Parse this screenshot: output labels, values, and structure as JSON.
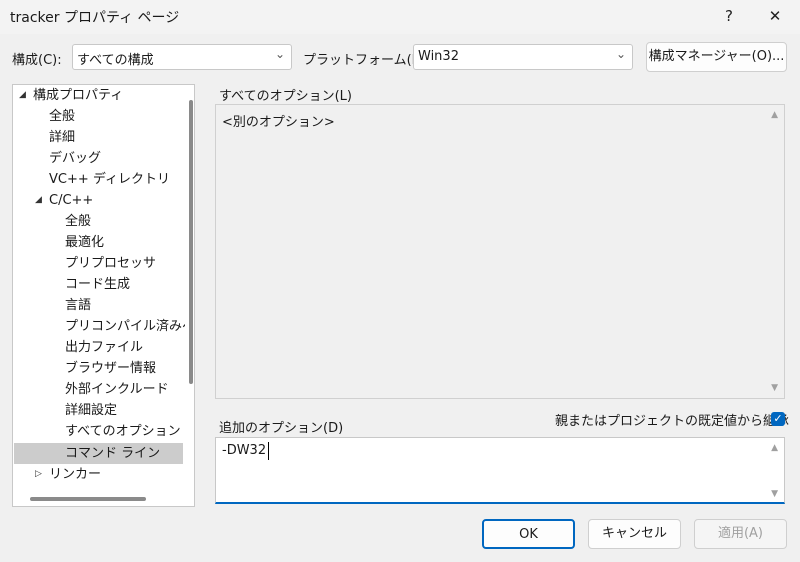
{
  "window": {
    "title": "tracker プロパティ ページ",
    "help_glyph": "?",
    "close_glyph": "✕"
  },
  "config": {
    "label": "構成(C):",
    "value": "すべての構成",
    "platform_label": "プラットフォーム(P):",
    "platform_value": "Win32",
    "manager_button": "構成マネージャー(O)..."
  },
  "tree": {
    "items": [
      {
        "label": "構成プロパティ",
        "expander": "◢"
      },
      {
        "label": "全般"
      },
      {
        "label": "詳細"
      },
      {
        "label": "デバッグ"
      },
      {
        "label": "VC++ ディレクトリ"
      },
      {
        "label": "C/C++",
        "expander": "◢"
      },
      {
        "label": "全般"
      },
      {
        "label": "最適化"
      },
      {
        "label": "プリプロセッサ"
      },
      {
        "label": "コード生成"
      },
      {
        "label": "言語"
      },
      {
        "label": "プリコンパイル済みヘッ"
      },
      {
        "label": "出力ファイル"
      },
      {
        "label": "ブラウザー情報"
      },
      {
        "label": "外部インクルード"
      },
      {
        "label": "詳細設定"
      },
      {
        "label": "すべてのオプション"
      },
      {
        "label": "コマンド ライン",
        "selected": true
      },
      {
        "label": "リンカー",
        "expander": "▷"
      }
    ]
  },
  "all_options": {
    "label": "すべてのオプション(L)",
    "content": "<別のオプション>"
  },
  "additional": {
    "label": "追加のオプション(D)",
    "inherit_label": "親またはプロジェクトの既定値から継承",
    "inherit_checked": true,
    "check_glyph": "✓",
    "value": "-DW32"
  },
  "buttons": {
    "ok": "OK",
    "cancel": "キャンセル",
    "apply": "適用(A)"
  },
  "colors": {
    "accent": "#0067c0",
    "selection": "#cccccc"
  }
}
